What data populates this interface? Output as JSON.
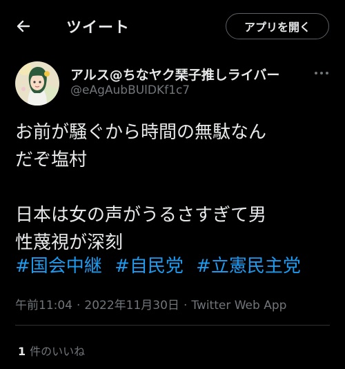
{
  "header": {
    "title": "ツイート",
    "open_app_label": "アプリを開く",
    "back_icon": "arrow-left-icon"
  },
  "tweet": {
    "author": {
      "display_name": "アルス@ちなヤク琹子推しライバー",
      "handle": "@eAgAubBUlDKf1c7"
    },
    "text_lines": [
      "お前が騒ぐから時間の無駄なん",
      "だぞ塩村",
      "",
      "日本は女の声がうるさすぎて男",
      "性蔑視が深刻"
    ],
    "hashtags": [
      "#国会中継",
      "#自民党",
      "#立憲民主党"
    ],
    "time": "午前11:04",
    "separator": "·",
    "date": "2022年11月30日",
    "source": "Twitter Web App",
    "likes": {
      "count": "1",
      "label": "件のいいね"
    }
  },
  "colors": {
    "background": "#000000",
    "text": "#e7e9ea",
    "secondary": "#71767b",
    "accent": "#1d9bf0",
    "divider": "#2f3336"
  }
}
